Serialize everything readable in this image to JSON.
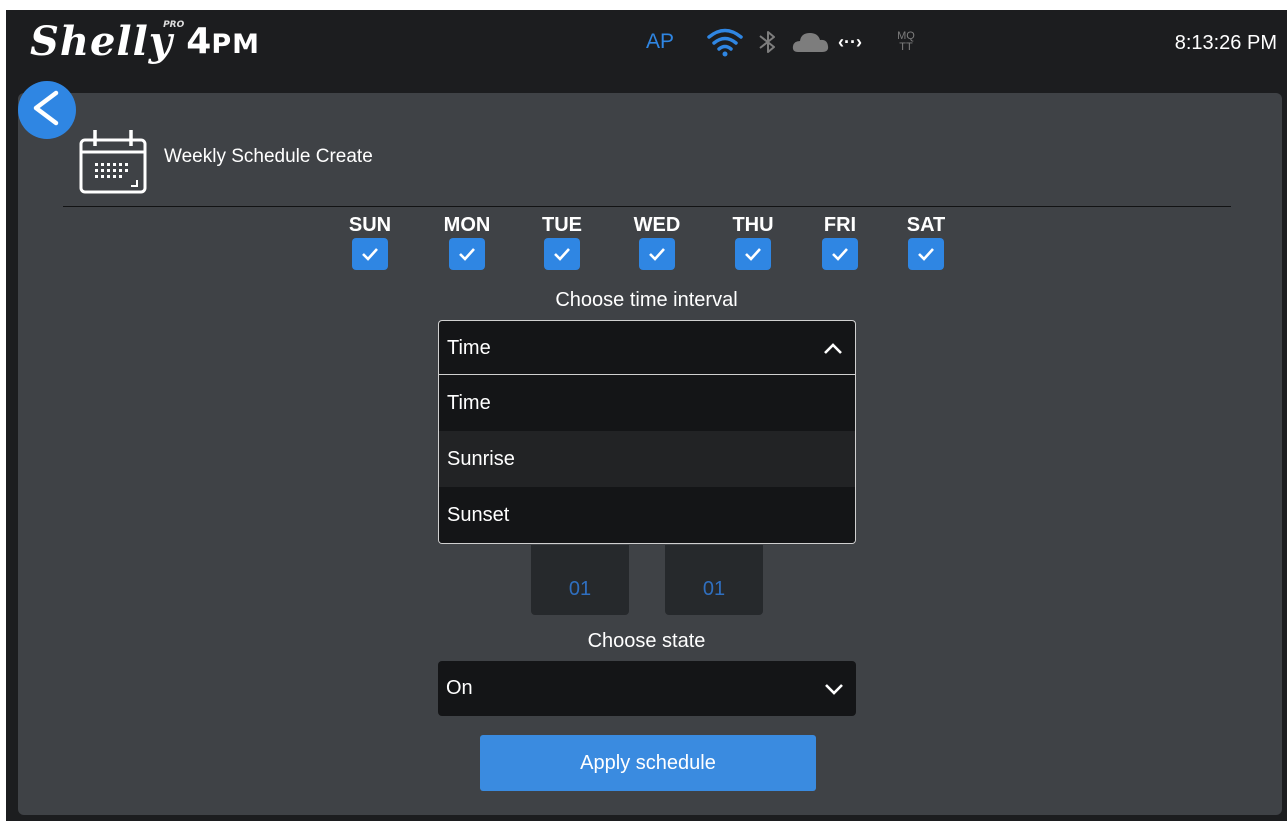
{
  "brand": {
    "name": "Shelly",
    "badge": "PRO",
    "model_num": "4",
    "model_suffix": "PM"
  },
  "status_bar": {
    "ap_label": "AP",
    "mqtt_line1": "MQ",
    "mqtt_line2": "TT",
    "arrows": "‹··›",
    "clock": "8:13:26 PM",
    "icons": [
      "wifi-icon",
      "bluetooth-icon",
      "cloud-icon",
      "connection-icon"
    ]
  },
  "page": {
    "title": "Weekly Schedule Create",
    "icon": "calendar-icon"
  },
  "days": [
    {
      "label": "SUN",
      "checked": true
    },
    {
      "label": "MON",
      "checked": true
    },
    {
      "label": "TUE",
      "checked": true
    },
    {
      "label": "WED",
      "checked": true
    },
    {
      "label": "THU",
      "checked": true
    },
    {
      "label": "FRI",
      "checked": true
    },
    {
      "label": "SAT",
      "checked": true
    }
  ],
  "interval": {
    "label": "Choose time interval",
    "selected": "Time",
    "options": [
      "Time",
      "Sunrise",
      "Sunset"
    ]
  },
  "time": {
    "hour": "01",
    "minute": "01"
  },
  "state": {
    "label": "Choose state",
    "selected": "On"
  },
  "apply_button": "Apply schedule",
  "colors": {
    "accent": "#2f86e3",
    "panel": "#3f4246",
    "background": "#1c1d1f"
  }
}
